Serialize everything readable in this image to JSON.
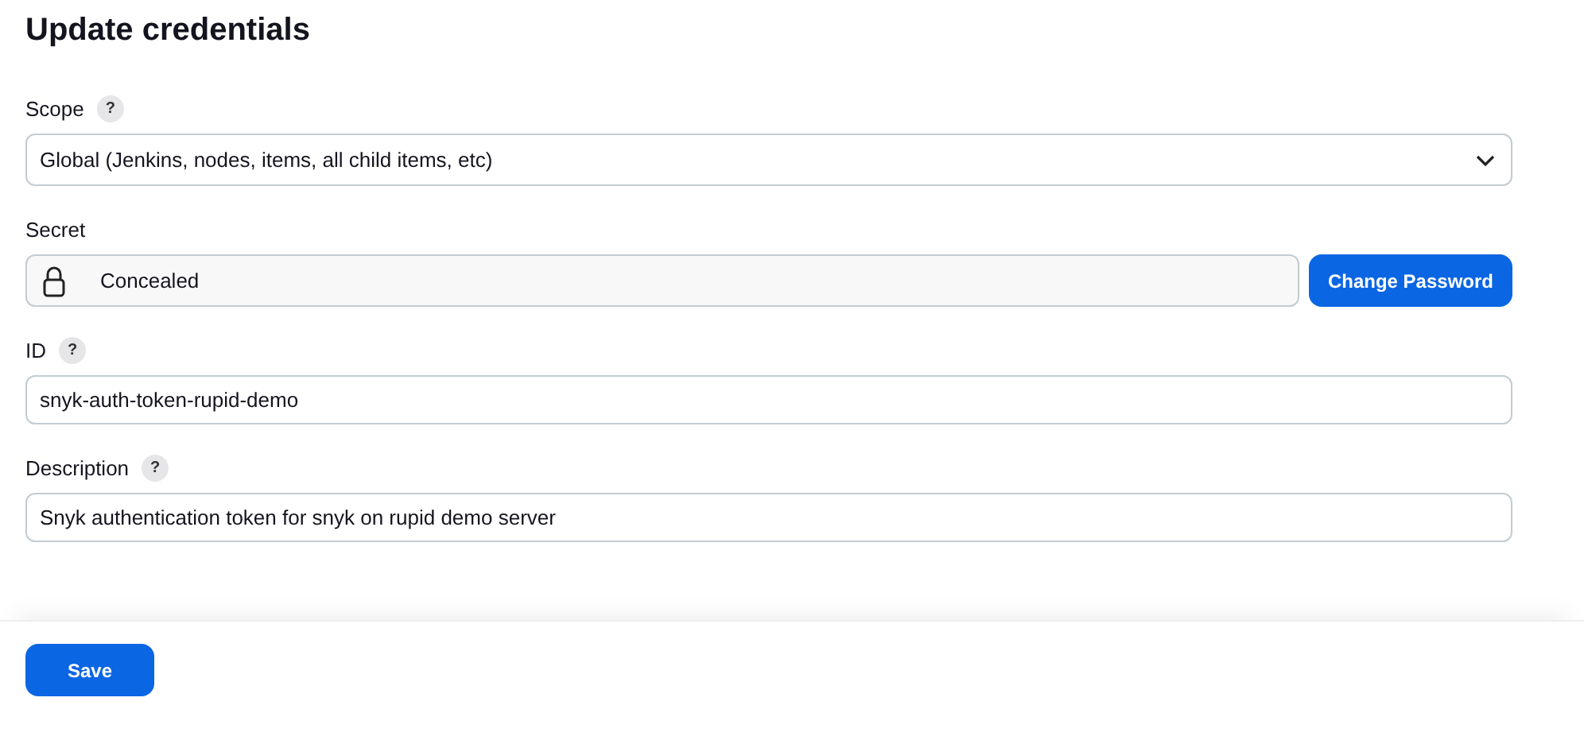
{
  "title": "Update credentials",
  "fields": [
    {
      "kind": "select",
      "label": "Scope",
      "help": "?",
      "value": "Global (Jenkins, nodes, items, all child items, etc)"
    },
    {
      "kind": "secret",
      "label": "Secret",
      "value": "Concealed",
      "button": "Change Password"
    },
    {
      "kind": "text",
      "label": "ID",
      "help": "?",
      "value": "snyk-auth-token-rupid-demo"
    },
    {
      "kind": "text",
      "label": "Description",
      "help": "?",
      "value": "Snyk authentication token for snyk on rupid demo server"
    }
  ],
  "save_button": "Save"
}
